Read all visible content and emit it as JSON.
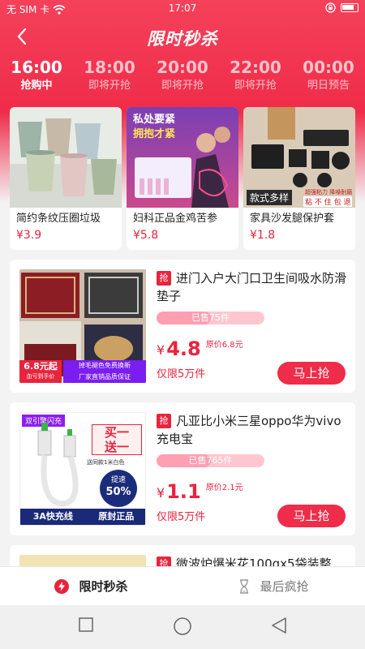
{
  "status_bar": {
    "carrier": "无 SIM 卡",
    "time": "17:07"
  },
  "header": {
    "title": "限时秒杀"
  },
  "time_tabs": [
    {
      "time": "16:00",
      "status": "抢购中",
      "active": true
    },
    {
      "time": "18:00",
      "status": "即将开抢",
      "active": false
    },
    {
      "time": "20:00",
      "status": "即将开抢",
      "active": false
    },
    {
      "time": "22:00",
      "status": "即将开抢",
      "active": false
    },
    {
      "time": "00:00",
      "status": "明日预告",
      "active": false
    }
  ],
  "top_products": [
    {
      "name": "简约条纹压圈垃圾",
      "price": "¥3.9"
    },
    {
      "name": "妇科正品金鸡苦参",
      "price": "¥5.8",
      "banner_line1": "私处要紧",
      "banner_line2": "拥抱才紧"
    },
    {
      "name": "家具沙发腿保护套",
      "price": "¥1.8",
      "tag_main": "款式多样",
      "tag_sub1": "超强粘力 降噪耐磨",
      "tag_sub2": "粘 不 住 包 退"
    }
  ],
  "list_products": [
    {
      "badge": "抢",
      "title": "进门入户大门口卫生间吸水防滑垫子",
      "sold": "已售75件",
      "sold_ratio": 0.5,
      "currency": "¥",
      "price": "4.8",
      "orig_price": "原价6.8元",
      "limit": "仅限5万件",
      "button": "马上抢",
      "img_price_tag": "6.8元起",
      "img_price_sub": "血亏到手价",
      "img_promo1": "掉毛褪色免费换新",
      "img_promo2": "厂家直销品质保证"
    },
    {
      "badge": "抢",
      "title": "凡亚比小米三星oppo华为vivo充电宝",
      "sold": "已售765件",
      "sold_ratio": 0.5,
      "currency": "¥",
      "price": "1.1",
      "orig_price": "原价2.1元",
      "limit": "仅限5万件",
      "button": "马上抢",
      "img_top": "双引擎闪充",
      "img_buy1": "买一",
      "img_buy2": "送一",
      "img_gift": "送同款1米白色",
      "img_speed": "提速",
      "img_speed_val": "50%",
      "img_bottom1": "3A快充线",
      "img_bottom2": "原封正品"
    },
    {
      "badge": "抢",
      "title": "微波炉爆米花100gx5袋装整"
    }
  ],
  "bottom_tabs": [
    {
      "label": "限时秒杀",
      "icon": "lightning-icon",
      "active": true
    },
    {
      "label": "最后疯抢",
      "icon": "hourglass-icon",
      "active": false
    }
  ],
  "colors": {
    "brand_red": "#ef2c49",
    "price_red": "#e8243d"
  }
}
